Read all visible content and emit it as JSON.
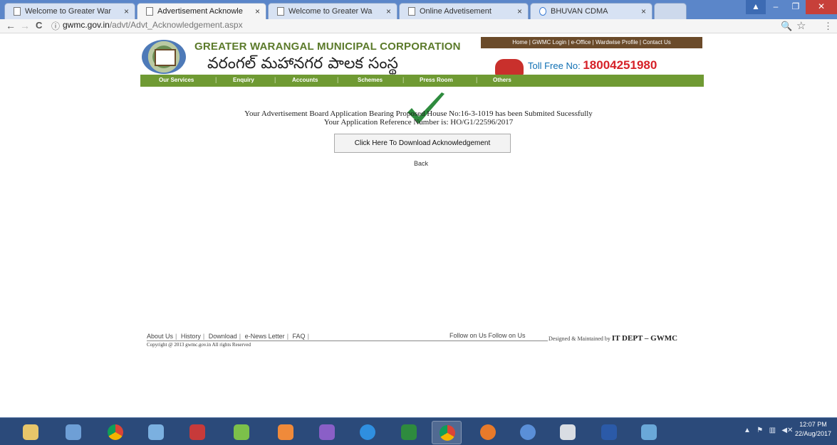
{
  "browser": {
    "tabs": [
      {
        "title": "Welcome to Greater War",
        "active": false
      },
      {
        "title": "Advertisement Acknowle",
        "active": true
      },
      {
        "title": "Welcome to Greater Wa",
        "active": false
      },
      {
        "title": "Online Advetisement",
        "active": false
      },
      {
        "title": "BHUVAN CDMA",
        "active": false
      }
    ],
    "url_host": "gwmc.gov.in",
    "url_path": "/advt/Advt_Acknowledgement.aspx",
    "tab_close_glyph": "×",
    "icons": {
      "back": "←",
      "forward": "→",
      "reload": "C",
      "info": "ⓘ",
      "zoom": "🔍",
      "star": "☆",
      "menu": "⋮"
    }
  },
  "header": {
    "corp_name_en": "GREATER WARANGAL MUNICIPAL CORPORATION",
    "corp_name_te": "వరంగల్ మహానగర పాలక సంస్థ",
    "top_nav": "Home | GWMC Login | e-Office | Wardwise Profile | Contact Us",
    "toll_free_label": "Toll Free No:",
    "toll_free_number": "18004251980"
  },
  "menu": {
    "items": [
      "Our Services",
      "Enquiry",
      "Accounts",
      "Schemes",
      "Press Room",
      "Others"
    ],
    "separator": "|"
  },
  "main": {
    "message_line1": "Your Advertisement Board Application Bearing Proposed House No:16-3-1019 has been Submited Sucessfully",
    "message_line2": "Your Application Reference Number is: HO/G1/22596/2017",
    "download_button": "Click Here To Download Acknowledgement",
    "back_link": "Back",
    "status_color": "#2e8b3e"
  },
  "footer": {
    "links": [
      "About Us",
      "History",
      "Download",
      "e-News Letter",
      "FAQ"
    ],
    "link_separator": "|",
    "follow": "Follow on Us  Follow on Us",
    "designed_prefix": "Designed & Maintained by",
    "designed_by": "IT DEPT – GWMC",
    "copyright": "Copyright @ 2013 gwmc.gov.in All rights Reserved"
  },
  "taskbar": {
    "apps": [
      "file-explorer",
      "task-manager",
      "chrome",
      "network-tool",
      "browser-app",
      "mascot-app",
      "media-app",
      "visual-studio",
      "internet-explorer",
      "excel",
      "chrome-active",
      "firefox",
      "itunes",
      "lock-app",
      "word",
      "misc-app"
    ],
    "clock_time": "12:07 PM",
    "clock_date": "22/Aug/2017"
  },
  "colors": {
    "brand_green": "#6f9a33",
    "brand_brown": "#6b4b2a",
    "toll_red": "#d62128"
  }
}
